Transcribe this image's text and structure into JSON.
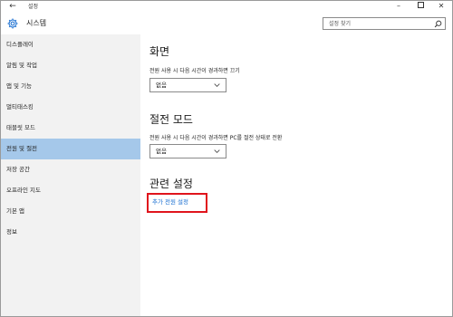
{
  "titlebar": {
    "back_glyph": "←",
    "title": "설정",
    "min_glyph": "–",
    "close_glyph": "✕"
  },
  "header": {
    "app_icon": "gear-icon",
    "title": "시스템",
    "search_placeholder": "설정 찾기",
    "search_icon": "search-icon"
  },
  "sidebar": {
    "items": [
      {
        "label": "디스플레이"
      },
      {
        "label": "알림 및 작업"
      },
      {
        "label": "앱 및 기능"
      },
      {
        "label": "멀티태스킹"
      },
      {
        "label": "태블릿 모드"
      },
      {
        "label": "전원 및 절전"
      },
      {
        "label": "저장 공간"
      },
      {
        "label": "오프라인 지도"
      },
      {
        "label": "기본 앱"
      },
      {
        "label": "정보"
      }
    ],
    "selected_index": 5,
    "selected_color": "#a5c8ea"
  },
  "main": {
    "screen": {
      "title": "화면",
      "label": "전원 사용 시 다음 시간이 경과하면 끄기",
      "value": "없음"
    },
    "sleep": {
      "title": "절전 모드",
      "label": "전원 사용 시 다음 시간이 경과하면 PC를 절전 상태로 전환",
      "value": "없음"
    },
    "related": {
      "title": "관련 설정",
      "link": "추가 전원 설정",
      "link_color": "#1a6fd1",
      "highlight_color": "#e0141c"
    }
  }
}
